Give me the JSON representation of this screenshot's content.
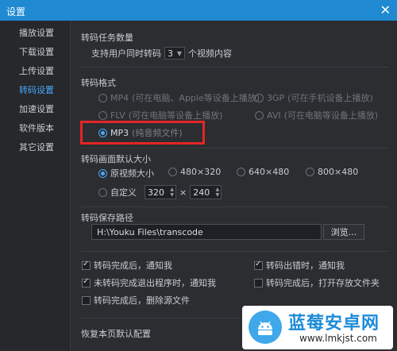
{
  "window": {
    "title": "设置",
    "close_glyph": "✕"
  },
  "sidebar": {
    "items": [
      {
        "label": "播放设置"
      },
      {
        "label": "下载设置"
      },
      {
        "label": "上传设置"
      },
      {
        "label": "转码设置",
        "active": true
      },
      {
        "label": "加速设置"
      },
      {
        "label": "软件版本"
      },
      {
        "label": "其它设置"
      }
    ]
  },
  "task_count": {
    "title": "转码任务数量",
    "prefix": "支持用户同时转码",
    "value": "3",
    "suffix": "个视频内容"
  },
  "format": {
    "title": "转码格式",
    "options": [
      {
        "label": "MP4",
        "note": "(可在电脑、Apple等设备上播放)",
        "selected": false
      },
      {
        "label": "3GP",
        "note": "(可在手机设备上播放)",
        "selected": false
      },
      {
        "label": "FLV",
        "note": "(可在电脑等设备上播放)",
        "selected": false
      },
      {
        "label": "AVI",
        "note": "(可在电脑等设备上播放)",
        "selected": false
      },
      {
        "label": "MP3",
        "note": "(纯音频文件)",
        "selected": true
      }
    ]
  },
  "size": {
    "title": "转码画面默认大小",
    "options": [
      {
        "label": "原视频大小",
        "selected": true
      },
      {
        "label": "480×320",
        "selected": false
      },
      {
        "label": "640×480",
        "selected": false
      },
      {
        "label": "800×480",
        "selected": false
      }
    ],
    "custom_label": "自定义",
    "width": "320",
    "times": "×",
    "height": "240"
  },
  "path": {
    "title": "转码保存路径",
    "value": "H:\\Youku Files\\transcode",
    "browse_label": "浏览..."
  },
  "options": [
    {
      "label": "转码完成后，通知我",
      "checked": true
    },
    {
      "label": "转码出错时，通知我",
      "checked": true
    },
    {
      "label": "未转码完成退出程序时，通知我",
      "checked": true
    },
    {
      "label": "转码完成后，打开存放文件夹",
      "checked": false
    },
    {
      "label": "转码完成后，删除源文件",
      "checked": false
    }
  ],
  "footer": {
    "restore_label": "恢复本页默认配置"
  },
  "watermark": {
    "brand": "蓝莓安卓网",
    "url": "www.lmkjst.com"
  }
}
